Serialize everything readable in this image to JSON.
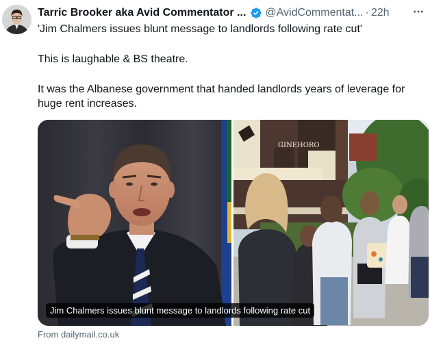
{
  "tweet": {
    "author": "Tarric Brooker aka Avid Commentator ...",
    "handle": "@AvidCommentat...",
    "separator": "·",
    "time": "22h",
    "lines": [
      "'Jim Chalmers issues blunt message to landlords following rate cut'",
      "This is laughable & BS theatre.",
      "It was the Albanese government that handed landlords years of leverage for huge rent increases."
    ]
  },
  "card": {
    "title": "Jim Chalmers issues blunt message to landlords following rate cut",
    "building_sign": "GINEHORO"
  },
  "source": "From dailymail.co.uk",
  "icons": {
    "verified": "verified-badge-icon",
    "more": "more-options-icon"
  },
  "colors": {
    "verified": "#1d9bf0",
    "secondary_text": "#536471",
    "primary_text": "#0f1419"
  }
}
